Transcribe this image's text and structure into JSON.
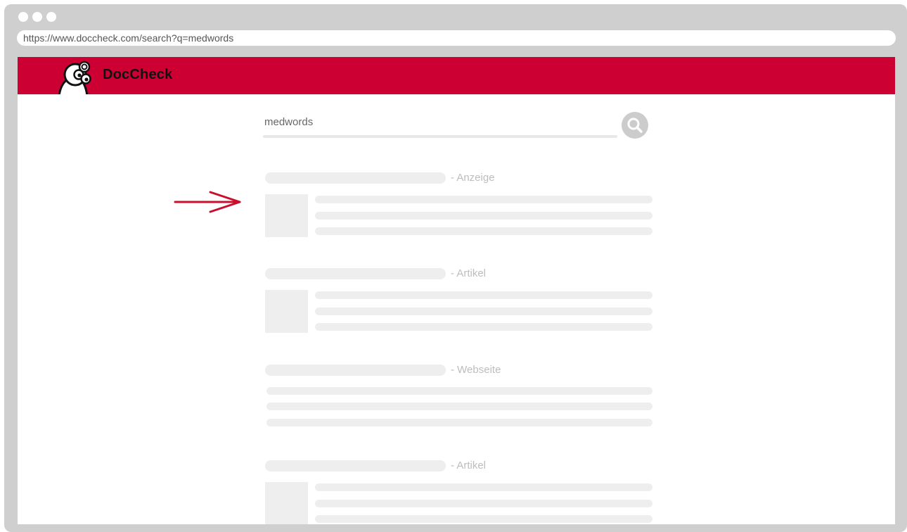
{
  "browser": {
    "url": "https://www.doccheck.com/search?q=medwords"
  },
  "header": {
    "brand": "DocCheck",
    "color": "#cc0033"
  },
  "search": {
    "value": "medwords",
    "button_icon": "search-icon"
  },
  "results": [
    {
      "type": "- Anzeige",
      "has_thumbnail": true
    },
    {
      "type": "- Artikel",
      "has_thumbnail": true
    },
    {
      "type": "- Webseite",
      "has_thumbnail": false
    },
    {
      "type": "- Artikel",
      "has_thumbnail": true
    }
  ],
  "annotation": {
    "icon": "arrow-right-icon",
    "color": "#c8102e"
  }
}
